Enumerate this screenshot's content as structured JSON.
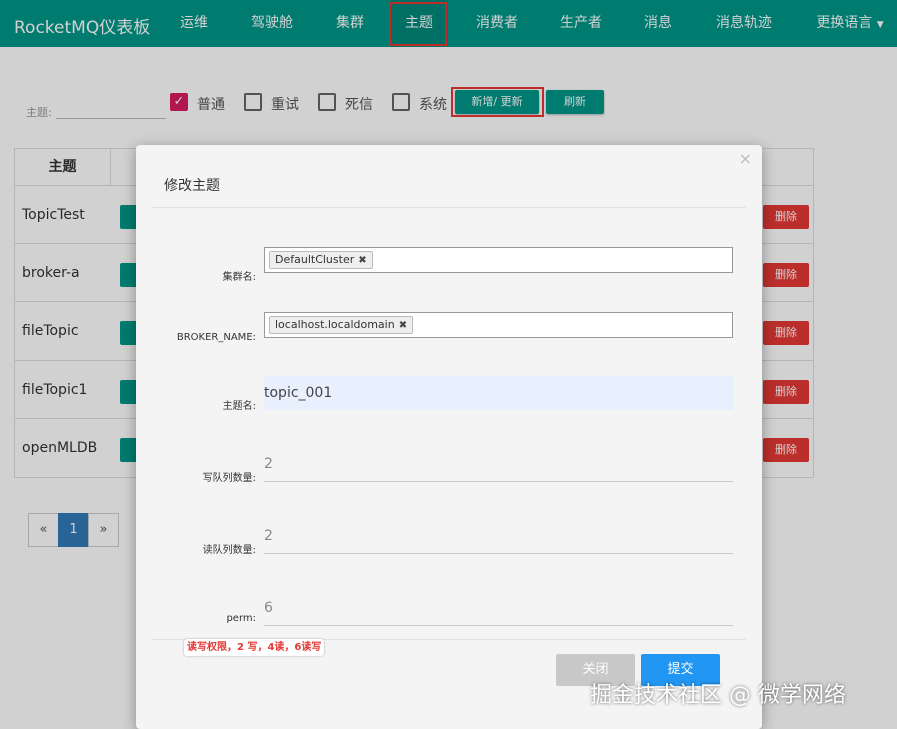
{
  "navbar": {
    "brand": "RocketMQ仪表板",
    "items": [
      "运维",
      "驾驶舱",
      "集群",
      "主题",
      "消费者",
      "生产者",
      "消息",
      "消息轨迹"
    ],
    "language": "更换语言",
    "active": "主题"
  },
  "filter": {
    "label": "主题:",
    "checkboxes": [
      {
        "label": "普通",
        "checked": true
      },
      {
        "label": "重试",
        "checked": false
      },
      {
        "label": "死信",
        "checked": false
      },
      {
        "label": "系统",
        "checked": false
      }
    ],
    "add_update_label": "新增/ 更新",
    "refresh_label": "刷新"
  },
  "table": {
    "header": "主题",
    "rows": [
      "TopicTest",
      "broker-a",
      "fileTopic",
      "fileTopic1",
      "openMLDB"
    ],
    "delete_label": "删除"
  },
  "pagination": {
    "prev": "«",
    "current": "1",
    "next": "»"
  },
  "modal": {
    "title": "修改主题",
    "close_icon": "×",
    "fields": {
      "cluster_label": "集群名:",
      "cluster_tag": "DefaultCluster",
      "broker_label": "BROKER_NAME:",
      "broker_tag": "localhost.localdomain",
      "topic_label": "主题名:",
      "topic_value": "topic_001",
      "write_label": "写队列数量:",
      "write_value": "2",
      "read_label": "读队列数量:",
      "read_value": "2",
      "perm_label": "perm:",
      "perm_value": "6"
    },
    "annotation": "读写权限，2 写，4读，6读写",
    "close_label": "关闭",
    "submit_label": "提交"
  },
  "watermark": "掘金技术社区 @ 微学网络",
  "colors": {
    "primary": "#009688",
    "danger": "#e53935",
    "submit": "#2196f3",
    "checkbox": "#d81b60"
  }
}
